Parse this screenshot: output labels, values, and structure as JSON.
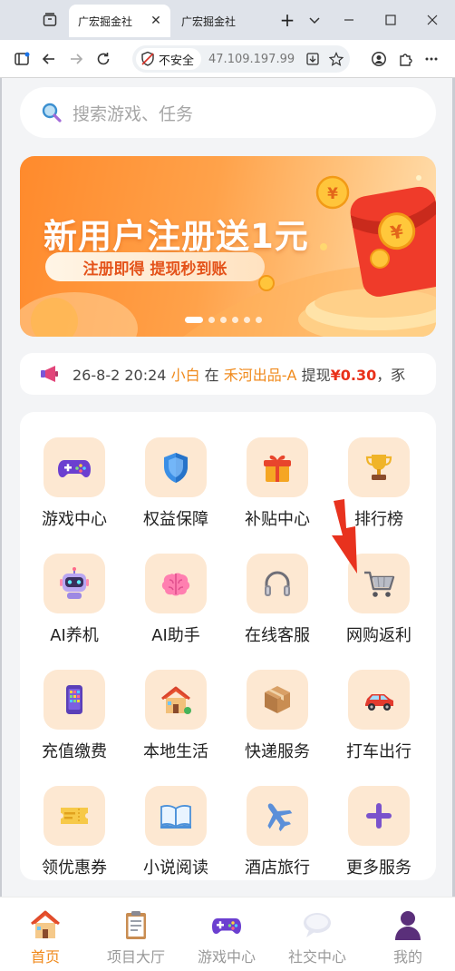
{
  "browser": {
    "tabs": [
      {
        "title": "广宏掘金社",
        "active": true
      },
      {
        "title": "广宏掘金社",
        "active": false
      }
    ],
    "security_label": "不安全",
    "url": "47.109.197.99"
  },
  "search": {
    "placeholder": "搜索游戏、任务"
  },
  "banner": {
    "title": "新用户注册送1元",
    "pill": "注册即得 提现秒到账",
    "slide_count": 6,
    "active_slide": 1
  },
  "notice": {
    "time": "26-8-2 20:24",
    "user": "小白",
    "word_in": "在",
    "game": "禾河出品-A",
    "action": "提现",
    "amount": "¥0.30",
    "trailing": "，豕"
  },
  "services": [
    {
      "label": "游戏中心",
      "icon": "gamepad-icon"
    },
    {
      "label": "权益保障",
      "icon": "shield-icon"
    },
    {
      "label": "补贴中心",
      "icon": "gift-icon"
    },
    {
      "label": "排行榜",
      "icon": "trophy-icon"
    },
    {
      "label": "AI养机",
      "icon": "robot-icon"
    },
    {
      "label": "AI助手",
      "icon": "brain-icon"
    },
    {
      "label": "在线客服",
      "icon": "headphones-icon"
    },
    {
      "label": "网购返利",
      "icon": "shopping-cart-icon"
    },
    {
      "label": "充值缴费",
      "icon": "phone-icon"
    },
    {
      "label": "本地生活",
      "icon": "house-icon"
    },
    {
      "label": "快递服务",
      "icon": "package-icon"
    },
    {
      "label": "打车出行",
      "icon": "car-icon"
    },
    {
      "label": "领优惠券",
      "icon": "ticket-icon"
    },
    {
      "label": "小说阅读",
      "icon": "book-icon"
    },
    {
      "label": "酒店旅行",
      "icon": "airplane-icon"
    },
    {
      "label": "更多服务",
      "icon": "plus-icon"
    }
  ],
  "bottom_nav": [
    {
      "label": "首页",
      "icon": "home-icon",
      "active": true
    },
    {
      "label": "项目大厅",
      "icon": "clipboard-icon",
      "active": false
    },
    {
      "label": "游戏中心",
      "icon": "gamepad-icon",
      "active": false
    },
    {
      "label": "社交中心",
      "icon": "chat-icon",
      "active": false
    },
    {
      "label": "我的",
      "icon": "user-icon",
      "active": false
    }
  ],
  "colors": {
    "accent": "#f08a1c",
    "banner_orange": "#ff8a2c",
    "amount_red": "#e9311a",
    "icon_tile": "#fde8d2",
    "page_bg": "#f3f4f6",
    "arrow_red": "#e8321e"
  }
}
